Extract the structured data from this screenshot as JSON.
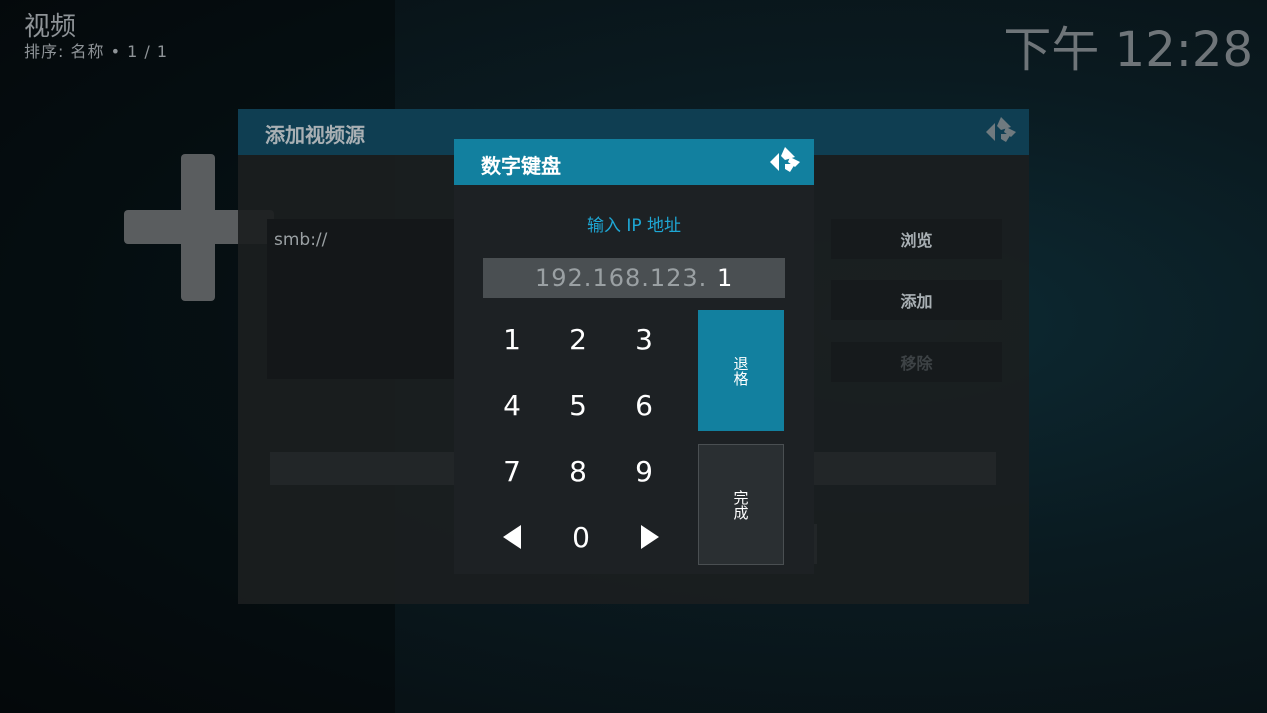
{
  "header": {
    "title": "视频",
    "subtitle": "排序: 名称 • 1 / 1",
    "clock": "下午 12:28"
  },
  "background_dialog": {
    "title": "添加视频源",
    "path_value": "smb://",
    "buttons": {
      "browse": "浏览",
      "add": "添加",
      "remove": "移除"
    }
  },
  "keypad": {
    "title": "数字键盘",
    "prompt": "输入 IP 地址",
    "ip_entered": "192.168.123.",
    "ip_current": "1",
    "keys": {
      "k1": "1",
      "k2": "2",
      "k3": "3",
      "k4": "4",
      "k5": "5",
      "k6": "6",
      "k7": "7",
      "k8": "8",
      "k9": "9",
      "k0": "0"
    },
    "backspace_label": "退格",
    "done_label": "完成"
  },
  "colors": {
    "accent": "#12809f",
    "prompt_text": "#1ea7d4"
  },
  "icons": {
    "logo": "kodi-logo-icon",
    "left": "arrow-left-icon",
    "right": "arrow-right-icon"
  }
}
